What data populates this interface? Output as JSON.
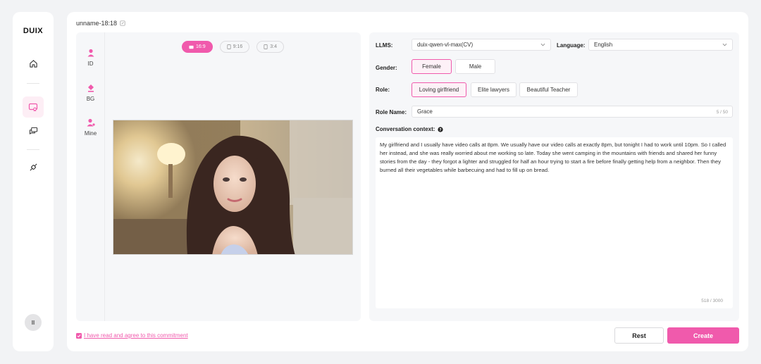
{
  "app": {
    "logo": "DUIX",
    "user_initial": "II"
  },
  "rail": {
    "icons": [
      "home-icon",
      "digital-human-icon",
      "chat-icon",
      "plugin-icon"
    ],
    "active": "digital-human-icon"
  },
  "project": {
    "title": "unname-18:18"
  },
  "preview": {
    "tabs": [
      {
        "label": "ID",
        "icon": "person-icon"
      },
      {
        "label": "BG",
        "icon": "paint-bucket-icon"
      },
      {
        "label": "Mine",
        "icon": "person-icon"
      }
    ],
    "ratios": [
      {
        "label": "16:9",
        "active": true
      },
      {
        "label": "9:16",
        "active": false
      },
      {
        "label": "3:4",
        "active": false
      }
    ]
  },
  "form": {
    "llms_label": "LLMS:",
    "llms_value": "duix-qwen-vl-max(CV)",
    "language_label": "Language:",
    "language_value": "English",
    "gender_label": "Gender:",
    "gender_options": [
      "Female",
      "Male"
    ],
    "gender_selected": "Female",
    "role_label": "Role:",
    "role_options": [
      "Loving girlfriend",
      "Elite lawyers",
      "Beautiful Teacher"
    ],
    "role_selected": "Loving girlfriend",
    "role_name_label": "Role Name:",
    "role_name_value": "Grace",
    "role_name_counter": "5 / 50",
    "context_label": "Conversation context:",
    "context_value": "My girlfriend and I usually have video calls at 8pm. We usually have our video calls at exactly 8pm, but tonight I had to work until 10pm. So I called her instead, and she was really worried about me working so late. Today she went camping in the mountains with friends and shared her funny stories from the day - they forgot a lighter and struggled for half an hour trying to start a fire before finally getting help from a neighbor. Then they burned all their vegetables while barbecuing and had to fill up on bread.",
    "context_counter": "518 / 3000"
  },
  "footer": {
    "agree_text": "I have read and agree to this commitment",
    "rest_label": "Rest",
    "create_label": "Create"
  },
  "colors": {
    "accent": "#f05aac",
    "background": "#f2f3f5"
  }
}
